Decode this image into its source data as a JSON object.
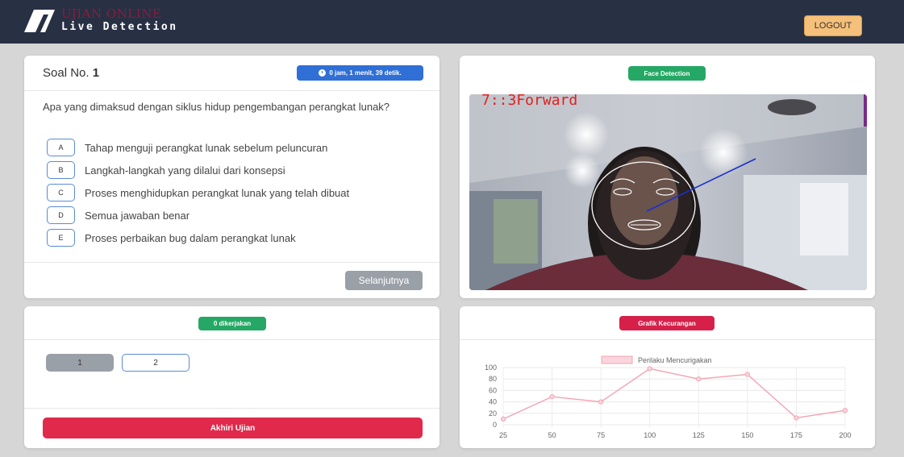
{
  "header": {
    "brand_title": "UJIAN ONLINE",
    "brand_subtitle": "Live Detection",
    "logout_label": "LOGOUT",
    "logo_icon": "logo-icon"
  },
  "question_card": {
    "title_prefix": "Soal No.",
    "number": "1",
    "timer": "0 jam, 1 menit, 39 detik.",
    "question": "Apa yang dimaksud dengan siklus hidup pengembangan perangkat lunak?",
    "options": [
      {
        "key": "A",
        "text": "Tahap menguji perangkat lunak sebelum peluncuran"
      },
      {
        "key": "B",
        "text": "Langkah-langkah yang dilalui dari konsepsi"
      },
      {
        "key": "C",
        "text": "Proses menghidupkan perangkat lunak yang telah dibuat"
      },
      {
        "key": "D",
        "text": "Semua jawaban benar"
      },
      {
        "key": "E",
        "text": "Proses perbaikan bug dalam perangkat lunak"
      }
    ],
    "next_label": "Selanjutnya"
  },
  "face_card": {
    "badge": "Face Detection",
    "overlay_text": "7::3Forward"
  },
  "progress_card": {
    "badge": "0 dikerjakan",
    "questions": [
      "1",
      "2"
    ],
    "end_label": "Akhiri Ujian"
  },
  "chart_card": {
    "badge": "Grafik Kecurangan"
  },
  "colors": {
    "topbar": "#283044",
    "timer_badge": "#2f6fd6",
    "success_badge": "#25a865",
    "danger": "#e0294b",
    "logout": "#f5c07a",
    "line": "#f4a3b4"
  },
  "chart_data": {
    "type": "line",
    "legend": "Perilaku Mencurigakan",
    "legend_position": "top",
    "x": [
      25,
      50,
      75,
      100,
      125,
      150,
      175,
      200
    ],
    "y": [
      10,
      49,
      40,
      98,
      80,
      88,
      12,
      25
    ],
    "yticks": [
      0,
      20,
      40,
      60,
      80,
      100
    ],
    "ylim": [
      0,
      100
    ],
    "grid": true
  }
}
